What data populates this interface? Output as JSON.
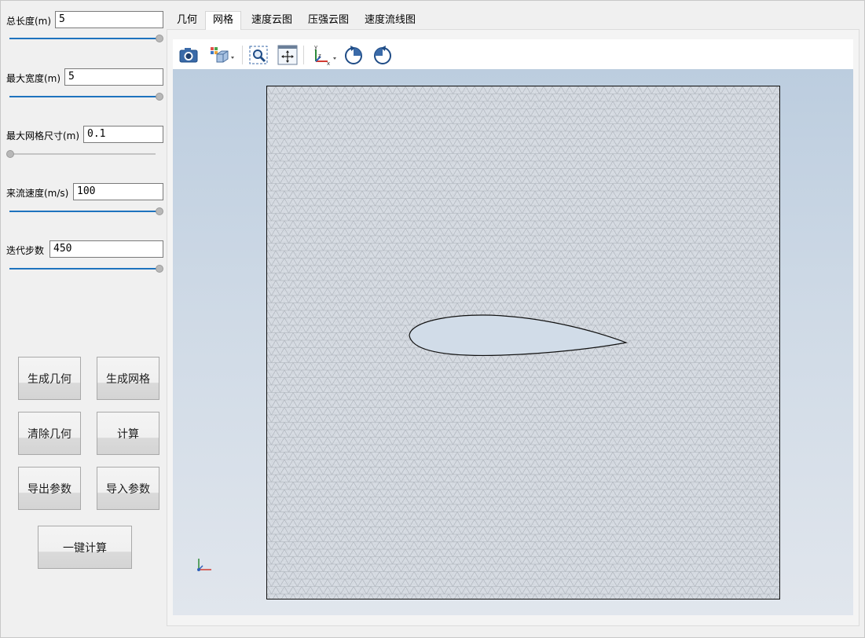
{
  "params": [
    {
      "key": "total_length",
      "label": "总长度(m)",
      "value": "5",
      "level": 1.0
    },
    {
      "key": "max_width",
      "label": "最大宽度(m)",
      "value": "5",
      "level": 1.0
    },
    {
      "key": "max_mesh_size",
      "label": "最大网格尺寸(m)",
      "value": "0.1",
      "level": 0.0
    },
    {
      "key": "inflow_speed",
      "label": "来流速度(m/s)",
      "value": "100",
      "level": 1.0
    },
    {
      "key": "iterations",
      "label": "迭代步数",
      "value": "450",
      "level": 1.0
    }
  ],
  "buttons": {
    "gen_geometry": "生成几何",
    "gen_mesh": "生成网格",
    "clear_geometry": "清除几何",
    "compute": "计算",
    "export_params": "导出参数",
    "import_params": "导入参数",
    "one_click": "一键计算"
  },
  "tabs": [
    {
      "label": "几何",
      "active": false
    },
    {
      "label": "网格",
      "active": true
    },
    {
      "label": "速度云图",
      "active": false
    },
    {
      "label": "压强云图",
      "active": false
    },
    {
      "label": "速度流线图",
      "active": false
    }
  ],
  "toolbar_icons": [
    "camera-icon",
    "view-cube-icon",
    "zoom-box-icon",
    "fit-view-icon",
    "axes-orientation-icon",
    "rotate-cw-icon",
    "rotate-ccw-icon"
  ],
  "axis_labels": {
    "x": "x",
    "y": "y",
    "z": "z"
  },
  "colors": {
    "accent": "#1e73be",
    "mesh_line": "#aab0b8",
    "viewport_top": "#bccddf",
    "viewport_bottom": "#e1e6ed"
  }
}
